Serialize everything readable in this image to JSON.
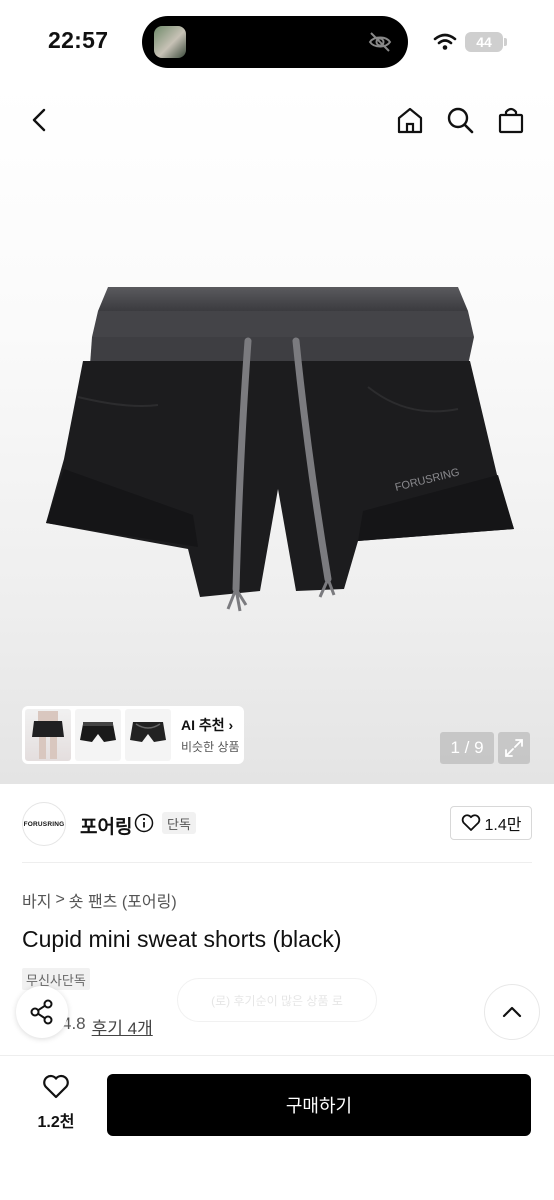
{
  "status_bar": {
    "time": "22:57",
    "battery": "44"
  },
  "gallery": {
    "ai_title": "AI 추천",
    "ai_chevron": "›",
    "ai_subtitle": "비슷한 상품",
    "pager": "1 / 9",
    "print_text": "FORUSRING"
  },
  "brand": {
    "logo_text": "FORUSRING",
    "name": "포어링",
    "exclusive_badge": "단독",
    "like_count": "1.4만"
  },
  "breadcrumb": {
    "category": "바지",
    "separator": ">",
    "subcategory": "숏 팬츠 (포어링)"
  },
  "product": {
    "title": "Cupid mini sweat shorts (black)",
    "tag": "무신사단독",
    "ghost_text": "(로) 후기순이 많은 상품 로",
    "rating": "4.8",
    "reviews": "후기 4개"
  },
  "bottom": {
    "like_count": "1.2천",
    "buy_label": "구매하기"
  },
  "colors": {
    "accent": "#000000",
    "background": "#ffffff"
  },
  "icons": [
    "back-icon",
    "home-icon",
    "search-icon",
    "bag-icon",
    "info-icon",
    "heart-icon",
    "share-icon",
    "chevron-up-icon",
    "expand-icon",
    "wifi-icon"
  ]
}
